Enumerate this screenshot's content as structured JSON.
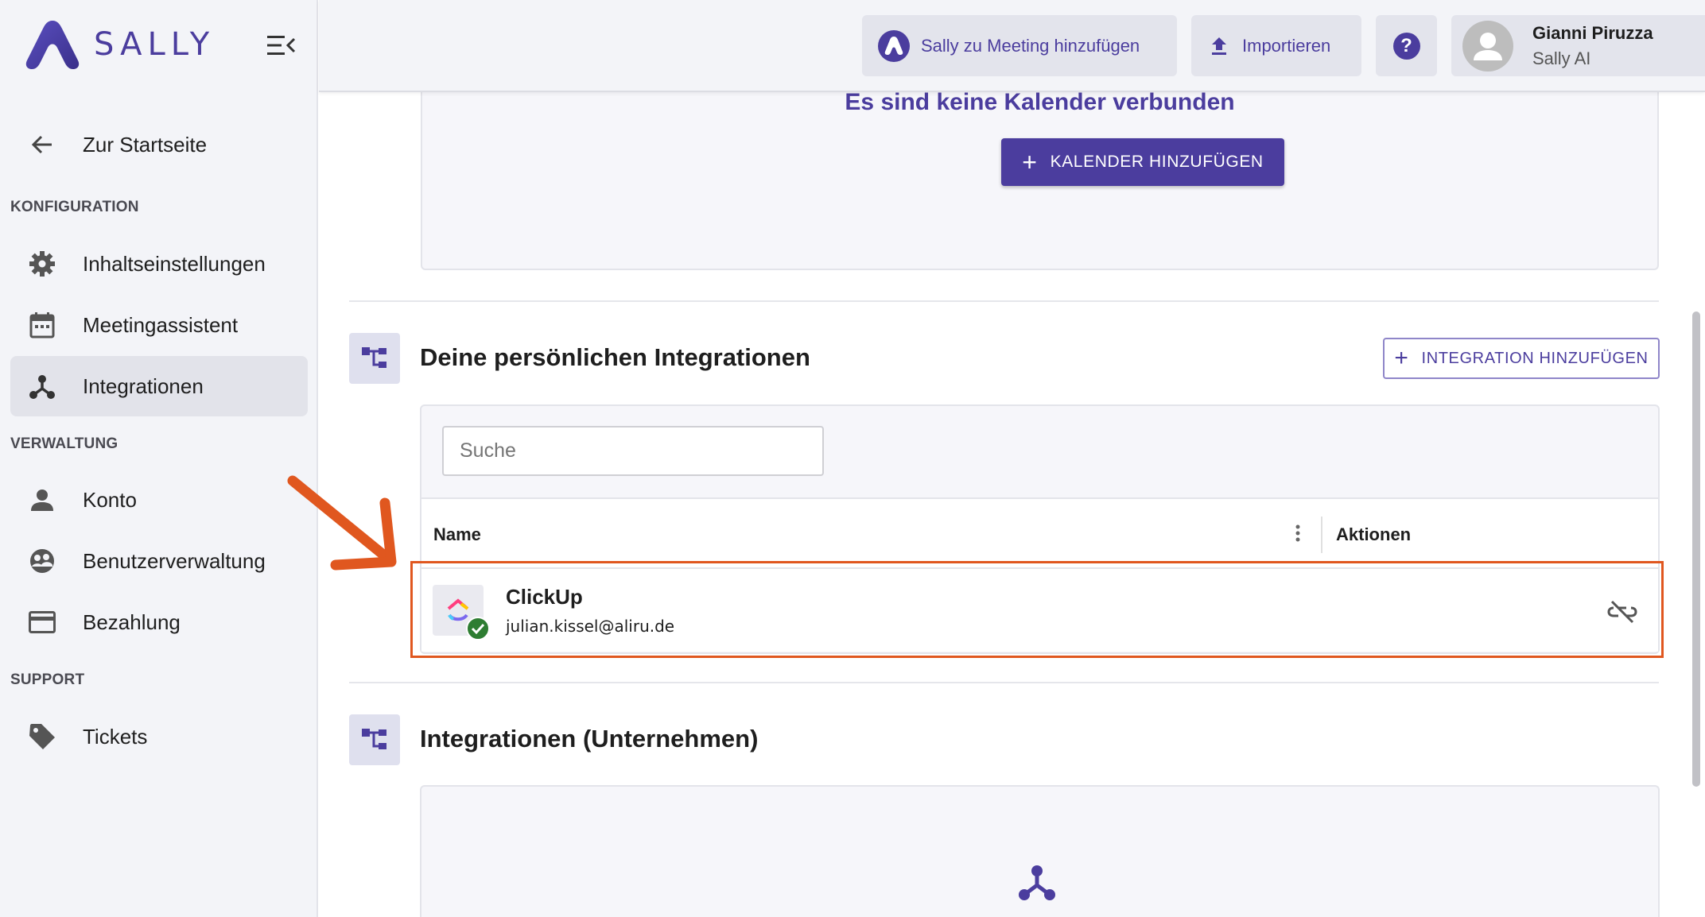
{
  "app": {
    "logo_text": "SALLY",
    "brand_color": "#4b3d9e",
    "annotation_color": "#e0571f"
  },
  "sidebar": {
    "back_label": "Zur Startseite",
    "sections": {
      "config": "KONFIGURATION",
      "admin": "VERWALTUNG",
      "support": "SUPPORT"
    },
    "items": [
      {
        "label": "Inhaltseinstellungen",
        "icon": "gear-icon"
      },
      {
        "label": "Meetingassistent",
        "icon": "calendar-icon"
      },
      {
        "label": "Integrationen",
        "icon": "integration-icon",
        "active": true
      },
      {
        "label": "Konto",
        "icon": "person-icon"
      },
      {
        "label": "Benutzerverwaltung",
        "icon": "users-icon"
      },
      {
        "label": "Bezahlung",
        "icon": "credit-card-icon"
      },
      {
        "label": "Tickets",
        "icon": "tag-icon"
      }
    ]
  },
  "header": {
    "add_meeting_label": "Sally zu Meeting hinzufügen",
    "import_label": "Importieren",
    "help_label": "?",
    "user_name": "Gianni Piruzza",
    "user_org": "Sally AI"
  },
  "calendar": {
    "empty_title": "Es sind keine Kalender verbunden",
    "add_button": "KALENDER HINZUFÜGEN"
  },
  "personal_integrations": {
    "title": "Deine persönlichen Integrationen",
    "add_button": "INTEGRATION HINZUFÜGEN",
    "search_placeholder": "Suche",
    "columns": {
      "name": "Name",
      "actions": "Aktionen"
    },
    "rows": [
      {
        "name": "ClickUp",
        "email": "julian.kissel@aliru.de",
        "status": "connected",
        "action_icon": "unlink-icon"
      }
    ]
  },
  "company_integrations": {
    "title": "Integrationen (Unternehmen)"
  }
}
